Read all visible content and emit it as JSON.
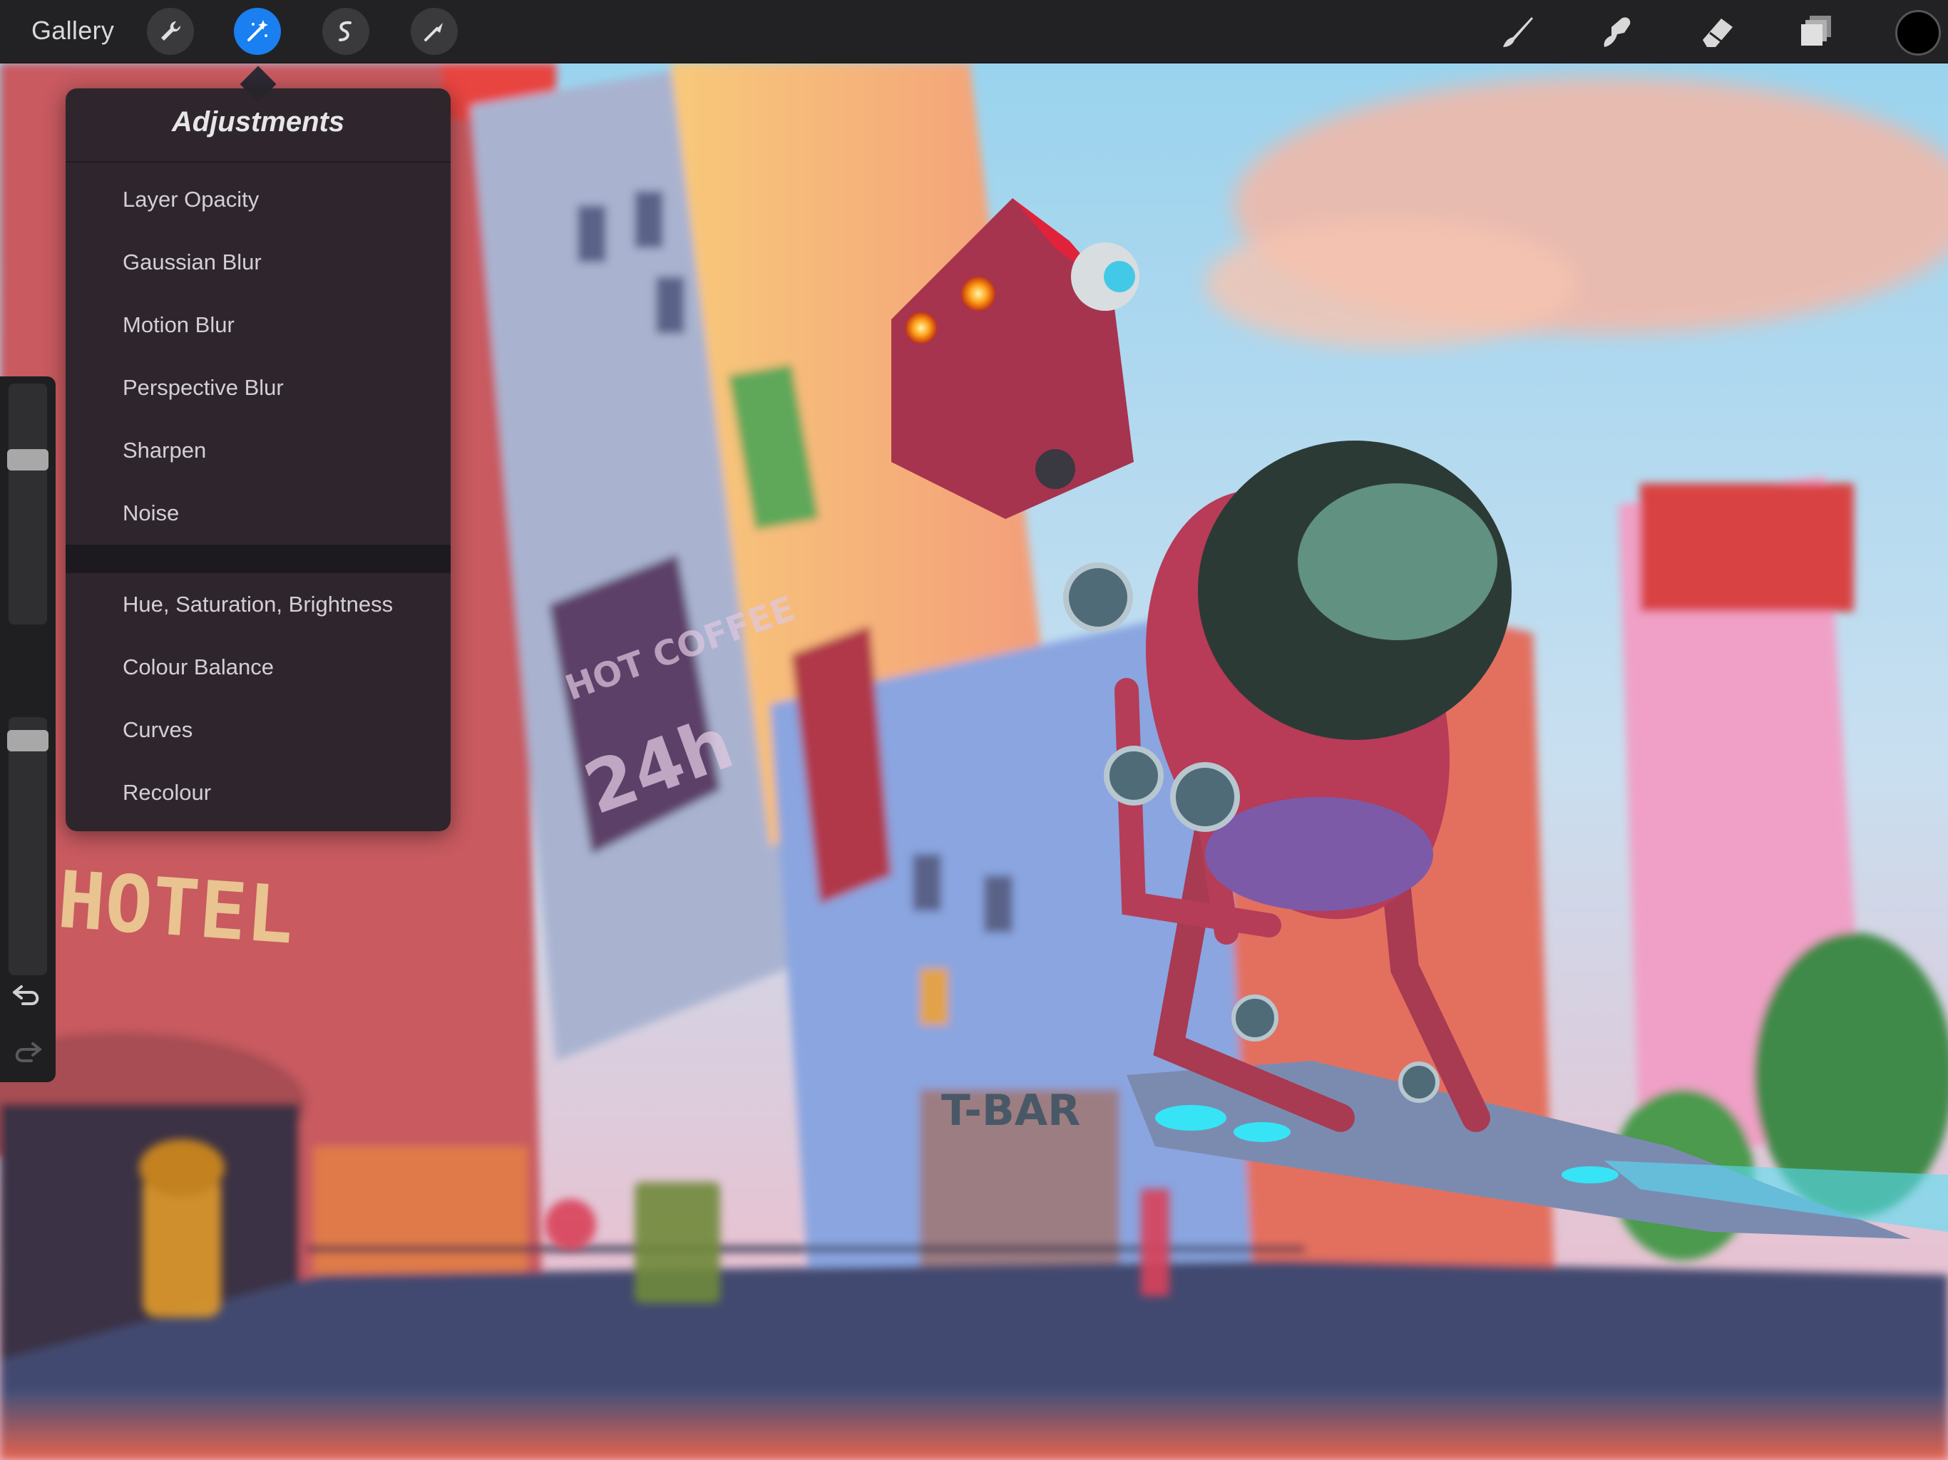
{
  "topbar": {
    "gallery_label": "Gallery",
    "left_tools": [
      {
        "name": "wrench-icon",
        "active": false
      },
      {
        "name": "magic-wand-icon",
        "active": true
      },
      {
        "name": "selection-icon",
        "active": false
      },
      {
        "name": "transform-arrow-icon",
        "active": false
      }
    ],
    "right_tools": [
      "brush-icon",
      "smudge-icon",
      "eraser-icon",
      "layers-icon"
    ],
    "current_color": "#000000",
    "accent_color": "#1a7ff0"
  },
  "adjustments": {
    "title": "Adjustments",
    "group_1": [
      "Layer Opacity",
      "Gaussian Blur",
      "Motion Blur",
      "Perspective Blur",
      "Sharpen",
      "Noise"
    ],
    "group_2": [
      "Hue, Saturation, Brightness",
      "Colour Balance",
      "Curves",
      "Recolour"
    ]
  },
  "sidebar": {
    "brush_size_level": 0.3,
    "opacity_level": 0.1,
    "undo_icon": "undo-icon",
    "redo_icon": "redo-icon"
  },
  "artwork": {
    "signs": [
      "HOTEL",
      "HOT COFFEE",
      "24h",
      "T-BAR"
    ]
  }
}
